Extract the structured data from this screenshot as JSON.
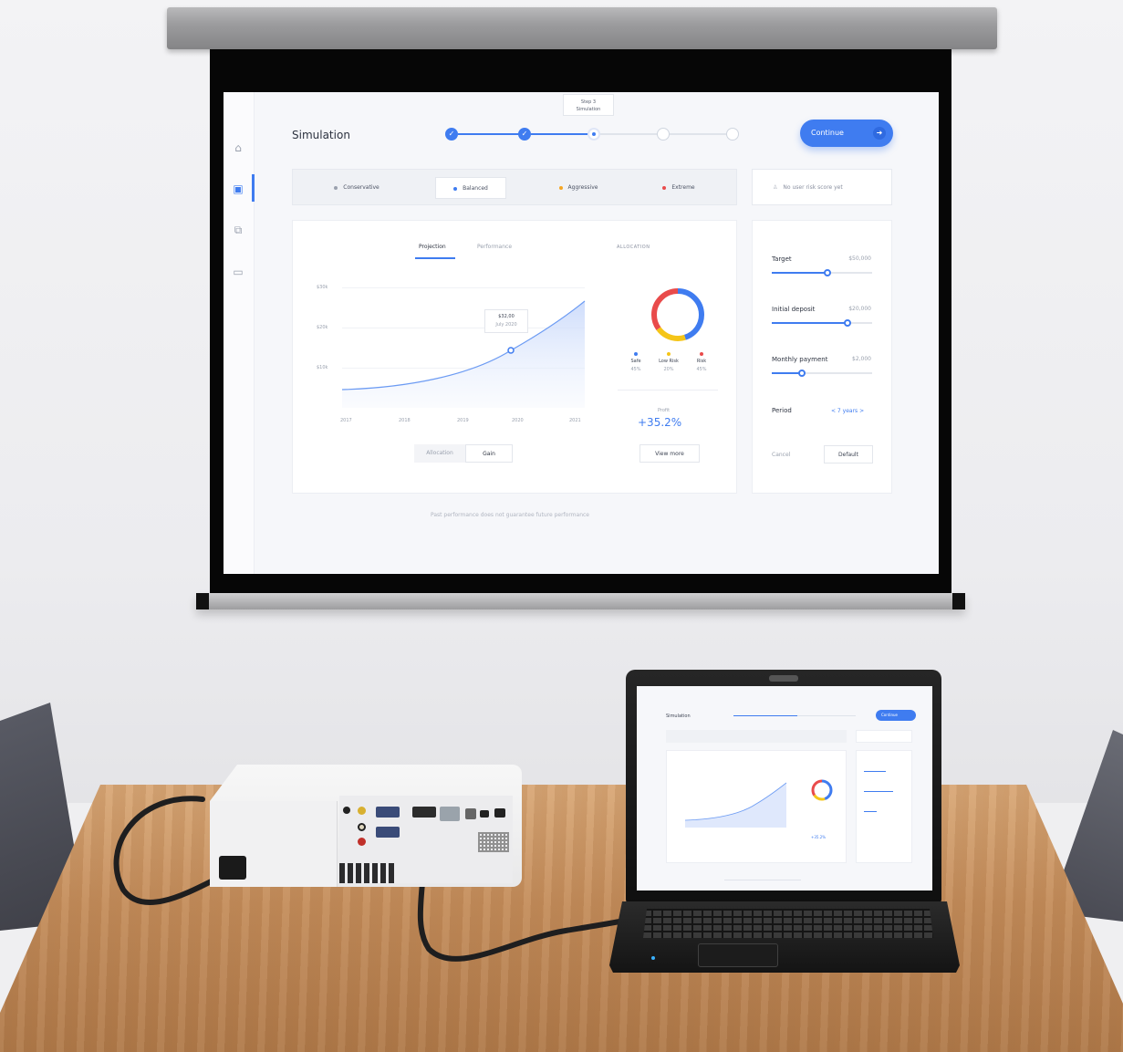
{
  "projected_app": {
    "title": "Simulation",
    "step_tooltip": {
      "line1": "Step 3",
      "line2": "Simulation"
    },
    "stepper": {
      "total_steps": 5,
      "current_step": 3
    },
    "continue_button": "Continue",
    "risk_options": [
      {
        "label": "Conservative",
        "color": "#9aa1ae"
      },
      {
        "label": "Balanced",
        "color": "#3f7cf0",
        "selected": true
      },
      {
        "label": "Aggressive",
        "color": "#f5a623"
      },
      {
        "label": "Extreme",
        "color": "#e94b4b"
      }
    ],
    "risk_note": "No user risk score yet",
    "tabs": {
      "projection": "Projection",
      "performance": "Performance"
    },
    "allocation_title": "ALLOCATION",
    "chart_tooltip": {
      "value": "$32,00",
      "date": "July 2020"
    },
    "view_toggle": {
      "allocation": "Allocation",
      "gain": "Gain"
    },
    "allocation_legend": [
      {
        "label": "Safe",
        "pct": "45%",
        "color": "#3f7cf0"
      },
      {
        "label": "Low Risk",
        "pct": "20%",
        "color": "#f5c518"
      },
      {
        "label": "Risk",
        "pct": "45%",
        "color": "#e94b4b"
      }
    ],
    "profit_label": "Profit",
    "profit_value": "+35.2%",
    "view_more": "View more",
    "sliders": [
      {
        "label": "Target",
        "value": "$50,000",
        "level": 0.55
      },
      {
        "label": "Initial deposit",
        "value": "$20,000",
        "level": 0.75
      },
      {
        "label": "Monthly payment",
        "value": "$2,000",
        "level": 0.3
      }
    ],
    "period": {
      "label": "Period",
      "value": "< 7 years >"
    },
    "cancel": "Cancel",
    "default_button": "Default",
    "disclaimer": "Past performance does not guarantee future performance"
  },
  "chart_data": {
    "type": "area",
    "x": [
      "2017",
      "2018",
      "2019",
      "2020",
      "2021"
    ],
    "y_ticks": [
      "$10k",
      "$20k",
      "$30k"
    ],
    "highlight": {
      "x": "2020",
      "label": "$32,00"
    },
    "donut": {
      "type": "pie",
      "categories": [
        "Safe",
        "Low Risk",
        "Risk"
      ],
      "values": [
        45,
        20,
        45
      ]
    }
  },
  "laptop_screen": {
    "title": "Simulation",
    "continue_button": "Continue",
    "profit_value": "+35.2%"
  },
  "colors": {
    "accent": "#3f7cf0",
    "wall": "#efeff1",
    "table": "#c48d5b"
  }
}
